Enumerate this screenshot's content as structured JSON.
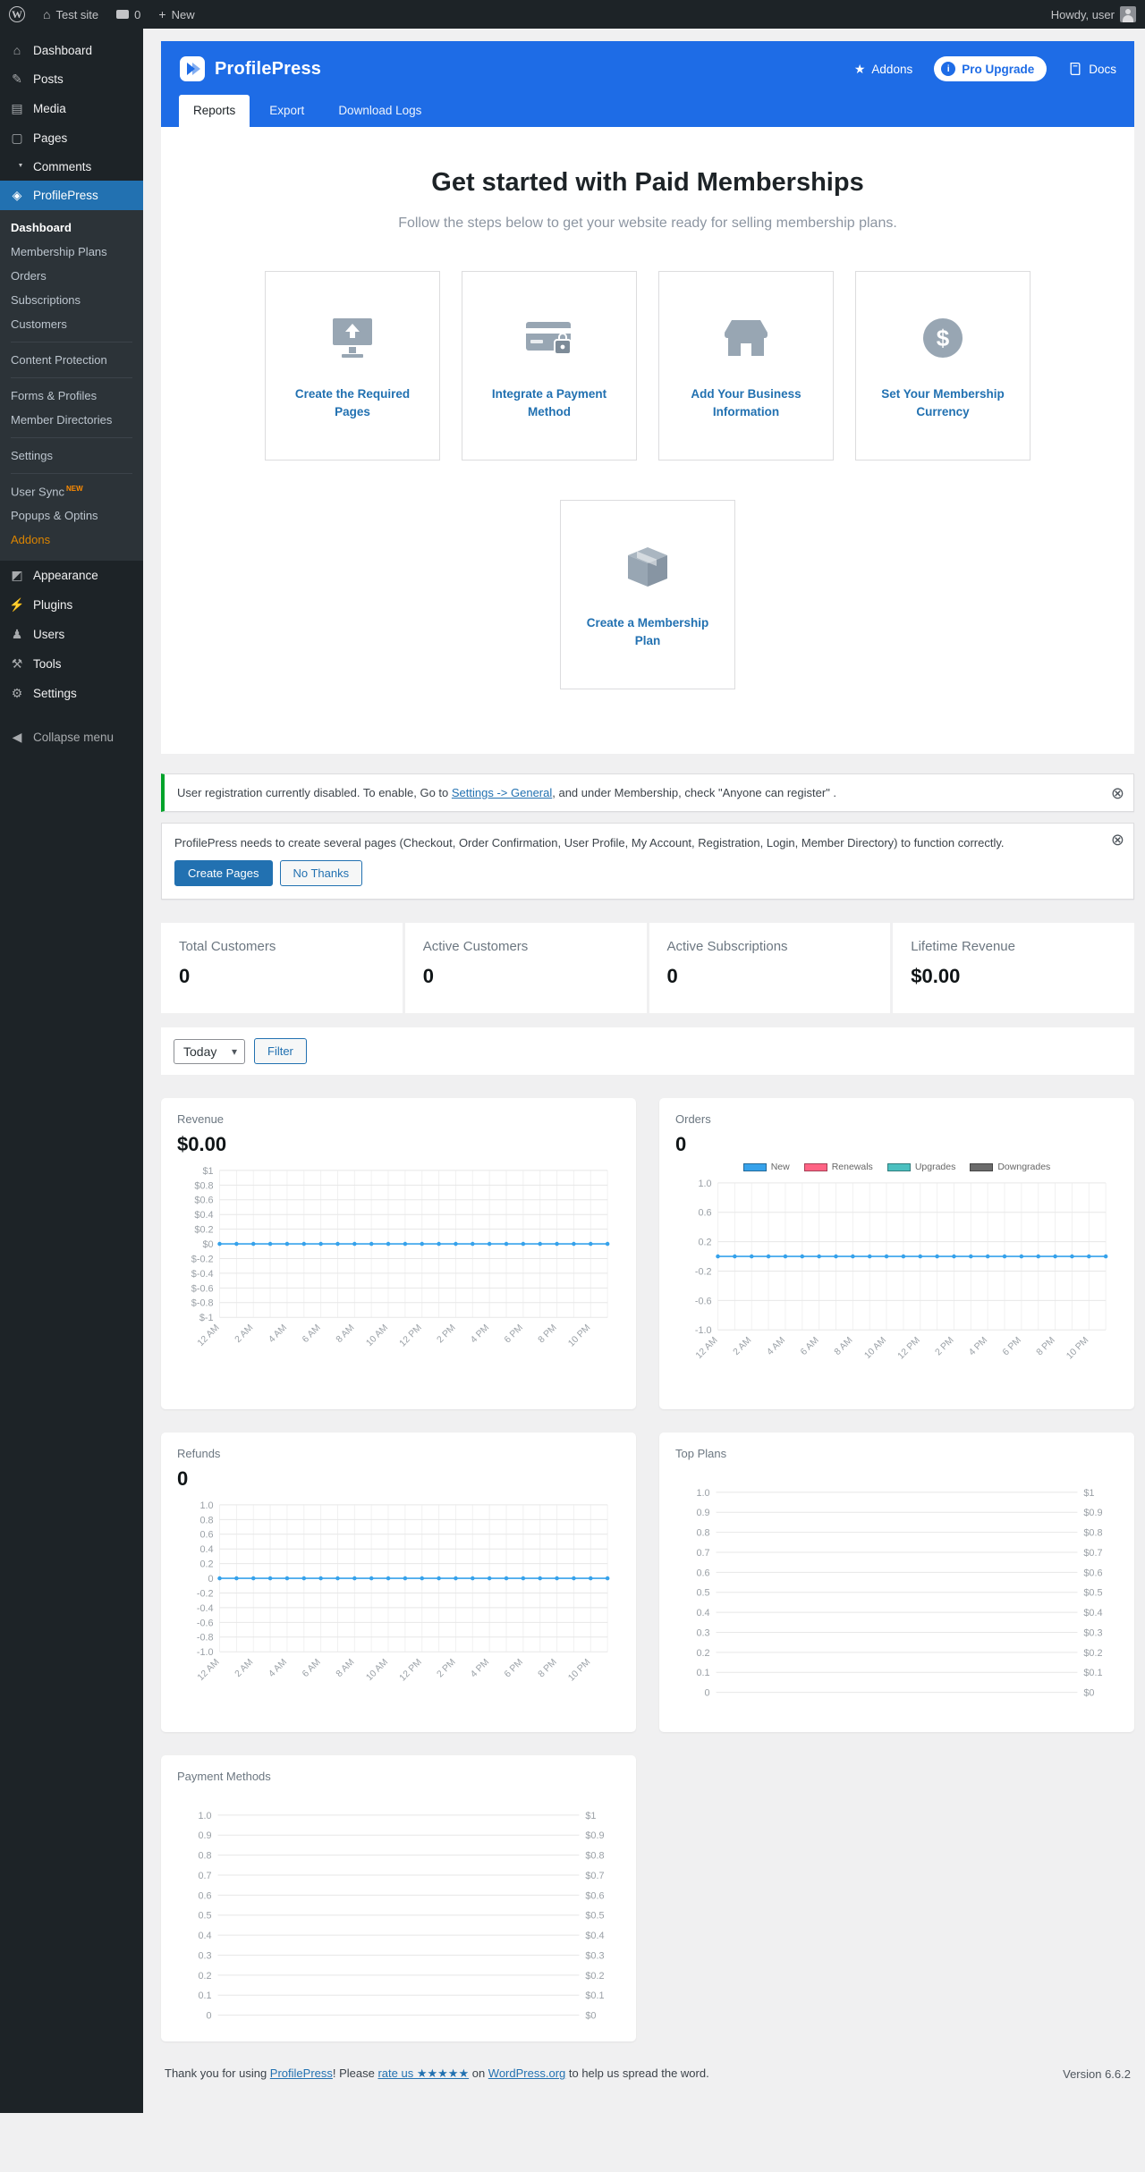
{
  "colors": {
    "admin_dark": "#1d2327",
    "submenu_dark": "#2c3338",
    "accent_blue": "#2271b1",
    "header_blue": "#1e6ce6",
    "success_green": "#00a32a",
    "addons_orange": "#dd8500",
    "badge_orange": "#ff8c00",
    "chart_blue": "#36a2eb",
    "icon_gray": "#98a6b3"
  },
  "icons": {
    "wp_logo": "W",
    "home": "⌂",
    "plus": "+",
    "star": "★",
    "info": "i",
    "dollar": "$",
    "dismiss": "⊗",
    "select_chevron": "▾"
  },
  "admin_bar": {
    "site_name": "Test site",
    "comments_count": "0",
    "new_label": "New",
    "howdy": "Howdy, user"
  },
  "sidebar": {
    "top": [
      {
        "label": "Dashboard",
        "glyph": "⌂"
      },
      {
        "label": "Posts",
        "glyph": "✎"
      },
      {
        "label": "Media",
        "glyph": "▤"
      },
      {
        "label": "Pages",
        "glyph": "▢"
      },
      {
        "label": "Comments",
        "glyph": ""
      }
    ],
    "profilepress": {
      "label": "ProfilePress",
      "glyph": "◈"
    },
    "submenu": [
      {
        "label": "Dashboard"
      },
      {
        "label": "Membership Plans"
      },
      {
        "label": "Orders"
      },
      {
        "label": "Subscriptions"
      },
      {
        "label": "Customers"
      },
      {
        "label": "Content Protection"
      },
      {
        "label": "Forms & Profiles"
      },
      {
        "label": "Member Directories"
      },
      {
        "label": "Settings"
      },
      {
        "label": "User Sync",
        "badge": "NEW"
      },
      {
        "label": "Popups & Optins"
      },
      {
        "label": "Addons"
      }
    ],
    "bottom": [
      {
        "label": "Appearance",
        "glyph": "◩"
      },
      {
        "label": "Plugins",
        "glyph": "⚡"
      },
      {
        "label": "Users",
        "glyph": "♟"
      },
      {
        "label": "Tools",
        "glyph": "⚒"
      },
      {
        "label": "Settings",
        "glyph": "⚙"
      }
    ],
    "collapse": {
      "label": "Collapse menu",
      "glyph": "◀"
    }
  },
  "header": {
    "brand": "ProfilePress",
    "addons_label": "Addons",
    "pro_upgrade_label": "Pro Upgrade",
    "docs_label": "Docs",
    "tabs": [
      "Reports",
      "Export",
      "Download Logs"
    ]
  },
  "get_started": {
    "title": "Get started with Paid Memberships",
    "subtitle": "Follow the steps below to get your website ready for selling membership plans.",
    "steps": [
      {
        "label": "Create the Required Pages"
      },
      {
        "label": "Integrate a Payment Method"
      },
      {
        "label": "Add Your Business Information"
      },
      {
        "label": "Set Your Membership Currency"
      },
      {
        "label": "Create a Membership Plan"
      }
    ]
  },
  "notices": {
    "registration": {
      "text_before": "User registration currently disabled. To enable, Go to ",
      "link": "Settings -> General",
      "text_after": ", and under Membership, check \"Anyone can register\" ."
    },
    "pages": {
      "text": "ProfilePress needs to create several pages (Checkout, Order Confirmation, User Profile, My Account, Registration, Login, Member Directory) to function correctly.",
      "create_button": "Create Pages",
      "dismiss_button": "No Thanks"
    }
  },
  "stats": [
    {
      "label": "Total Customers",
      "value": "0"
    },
    {
      "label": "Active Customers",
      "value": "0"
    },
    {
      "label": "Active Subscriptions",
      "value": "0"
    },
    {
      "label": "Lifetime Revenue",
      "value": "$0.00"
    }
  ],
  "filter": {
    "range_value": "Today",
    "filter_label": "Filter"
  },
  "chart_data": [
    {
      "id": "revenue",
      "type": "line",
      "title": "Revenue",
      "total": "$0.00",
      "ylim": [
        -1,
        1
      ],
      "y_ticks": [
        "$1",
        "$0.8",
        "$0.6",
        "$0.4",
        "$0.2",
        "$0",
        "$-0.2",
        "$-0.4",
        "$-0.6",
        "$-0.8",
        "$-1"
      ],
      "points": 24,
      "x_ticks": [
        "12 AM",
        "2 AM",
        "4 AM",
        "6 AM",
        "8 AM",
        "10 AM",
        "12 PM",
        "2 PM",
        "4 PM",
        "6 PM",
        "8 PM",
        "10 PM"
      ],
      "series": [
        {
          "name": "Revenue",
          "color": "#36a2eb",
          "values": [
            0,
            0,
            0,
            0,
            0,
            0,
            0,
            0,
            0,
            0,
            0,
            0,
            0,
            0,
            0,
            0,
            0,
            0,
            0,
            0,
            0,
            0,
            0,
            0
          ]
        }
      ]
    },
    {
      "id": "orders",
      "type": "line",
      "title": "Orders",
      "total": "0",
      "legend": [
        {
          "label": "New",
          "color": "#36a2eb"
        },
        {
          "label": "Renewals",
          "color": "#ff6384"
        },
        {
          "label": "Upgrades",
          "color": "#4bc0c0"
        },
        {
          "label": "Downgrades",
          "color": "#6b6b6b"
        }
      ],
      "ylim": [
        -1,
        1
      ],
      "y_ticks": [
        "1.0",
        "0.6",
        "0.2",
        "-0.2",
        "-0.6",
        "-1.0"
      ],
      "points": 24,
      "x_ticks": [
        "12 AM",
        "2 AM",
        "4 AM",
        "6 AM",
        "8 AM",
        "10 AM",
        "12 PM",
        "2 PM",
        "4 PM",
        "6 PM",
        "8 PM",
        "10 PM"
      ],
      "series": [
        {
          "name": "New",
          "color": "#36a2eb",
          "values": [
            0,
            0,
            0,
            0,
            0,
            0,
            0,
            0,
            0,
            0,
            0,
            0,
            0,
            0,
            0,
            0,
            0,
            0,
            0,
            0,
            0,
            0,
            0,
            0
          ]
        }
      ]
    },
    {
      "id": "refunds",
      "type": "line",
      "title": "Refunds",
      "total": "0",
      "ylim": [
        -1,
        1
      ],
      "y_ticks": [
        "1.0",
        "0.8",
        "0.6",
        "0.4",
        "0.2",
        "0",
        "-0.2",
        "-0.4",
        "-0.6",
        "-0.8",
        "-1.0"
      ],
      "points": 24,
      "x_ticks": [
        "12 AM",
        "2 AM",
        "4 AM",
        "6 AM",
        "8 AM",
        "10 AM",
        "12 PM",
        "2 PM",
        "4 PM",
        "6 PM",
        "8 PM",
        "10 PM"
      ],
      "series": [
        {
          "name": "Refunds",
          "color": "#36a2eb",
          "values": [
            0,
            0,
            0,
            0,
            0,
            0,
            0,
            0,
            0,
            0,
            0,
            0,
            0,
            0,
            0,
            0,
            0,
            0,
            0,
            0,
            0,
            0,
            0,
            0
          ]
        }
      ]
    },
    {
      "id": "top_plans",
      "type": "line",
      "title": "Top Plans",
      "ylim": [
        0,
        1
      ],
      "y_ticks": [
        "1.0",
        "0.9",
        "0.8",
        "0.7",
        "0.6",
        "0.5",
        "0.4",
        "0.3",
        "0.2",
        "0.1",
        "0"
      ],
      "y_right": [
        "$1",
        "$0.9",
        "$0.8",
        "$0.7",
        "$0.6",
        "$0.5",
        "$0.4",
        "$0.3",
        "$0.2",
        "$0.1",
        "$0"
      ],
      "series": []
    },
    {
      "id": "payment_methods",
      "type": "line",
      "title": "Payment Methods",
      "ylim": [
        0,
        1
      ],
      "y_ticks": [
        "1.0",
        "0.9",
        "0.8",
        "0.7",
        "0.6",
        "0.5",
        "0.4",
        "0.3",
        "0.2",
        "0.1",
        "0"
      ],
      "y_right": [
        "$1",
        "$0.9",
        "$0.8",
        "$0.7",
        "$0.6",
        "$0.5",
        "$0.4",
        "$0.3",
        "$0.2",
        "$0.1",
        "$0"
      ],
      "series": []
    }
  ],
  "footer": {
    "text_before": "Thank you for using ",
    "link_profilepress": "ProfilePress",
    "mid1": "! Please ",
    "link_rate": "rate us ★★★★★",
    "mid2": " on ",
    "link_wordpress": "WordPress.org",
    "text_after": " to help us spread the word.",
    "version": "Version 6.6.2"
  }
}
